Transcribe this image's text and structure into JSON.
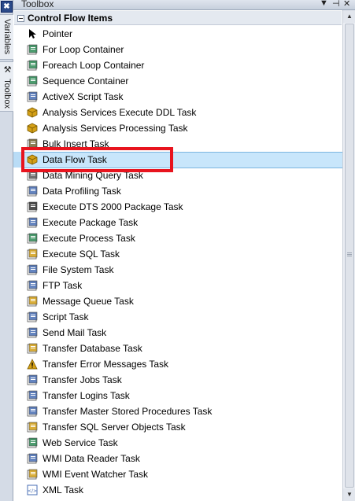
{
  "window": {
    "title": "Toolbox",
    "dropdown_glyph": "▼",
    "pin_glyph": "📌",
    "close_glyph": "✕"
  },
  "side_tabs": {
    "top_icon": "✖",
    "variables": "Variables",
    "toolbox": "Toolbox"
  },
  "group": {
    "label": "Control Flow Items"
  },
  "items": [
    {
      "label": "Pointer",
      "icon": "pointer-icon",
      "color": "#000000"
    },
    {
      "label": "For Loop Container",
      "icon": "for-loop-icon",
      "color": "#2e8b57"
    },
    {
      "label": "Foreach Loop Container",
      "icon": "foreach-loop-icon",
      "color": "#2e8b57"
    },
    {
      "label": "Sequence Container",
      "icon": "sequence-icon",
      "color": "#2e8b57"
    },
    {
      "label": "ActiveX Script Task",
      "icon": "activex-icon",
      "color": "#4a6fb5"
    },
    {
      "label": "Analysis Services Execute DDL Task",
      "icon": "cube-icon",
      "color": "#d4a017"
    },
    {
      "label": "Analysis Services Processing Task",
      "icon": "cube-icon",
      "color": "#d4a017"
    },
    {
      "label": "Bulk Insert Task",
      "icon": "bulk-insert-icon",
      "color": "#7a6a3a"
    },
    {
      "label": "Data Flow Task",
      "icon": "data-flow-icon",
      "color": "#d4a017"
    },
    {
      "label": "Data Mining Query Task",
      "icon": "mining-icon",
      "color": "#5a5a5a"
    },
    {
      "label": "Data Profiling Task",
      "icon": "profiling-icon",
      "color": "#4a6fb5"
    },
    {
      "label": "Execute DTS 2000 Package Task",
      "icon": "dts-icon",
      "color": "#333333"
    },
    {
      "label": "Execute Package Task",
      "icon": "package-icon",
      "color": "#4a6fb5"
    },
    {
      "label": "Execute Process Task",
      "icon": "process-icon",
      "color": "#2e8b57"
    },
    {
      "label": "Execute SQL Task",
      "icon": "sql-icon",
      "color": "#d4a017"
    },
    {
      "label": "File System Task",
      "icon": "file-system-icon",
      "color": "#4a6fb5"
    },
    {
      "label": "FTP Task",
      "icon": "ftp-icon",
      "color": "#4a6fb5"
    },
    {
      "label": "Message Queue Task",
      "icon": "message-queue-icon",
      "color": "#d4a017"
    },
    {
      "label": "Script Task",
      "icon": "script-icon",
      "color": "#4a6fb5"
    },
    {
      "label": "Send Mail Task",
      "icon": "mail-icon",
      "color": "#4a6fb5"
    },
    {
      "label": "Transfer Database Task",
      "icon": "transfer-db-icon",
      "color": "#d4a017"
    },
    {
      "label": "Transfer Error Messages Task",
      "icon": "warning-icon",
      "color": "#d4a017"
    },
    {
      "label": "Transfer Jobs Task",
      "icon": "jobs-icon",
      "color": "#4a6fb5"
    },
    {
      "label": "Transfer Logins Task",
      "icon": "logins-icon",
      "color": "#4a6fb5"
    },
    {
      "label": "Transfer Master Stored Procedures Task",
      "icon": "stored-proc-icon",
      "color": "#4a6fb5"
    },
    {
      "label": "Transfer SQL Server Objects Task",
      "icon": "sql-objects-icon",
      "color": "#d4a017"
    },
    {
      "label": "Web Service Task",
      "icon": "web-service-icon",
      "color": "#2e8b57"
    },
    {
      "label": "WMI Data Reader Task",
      "icon": "wmi-reader-icon",
      "color": "#4a6fb5"
    },
    {
      "label": "WMI Event Watcher Task",
      "icon": "wmi-watcher-icon",
      "color": "#d4a017"
    },
    {
      "label": "XML Task",
      "icon": "xml-icon",
      "color": "#4a6fb5"
    }
  ],
  "selected_index": 8,
  "colors": {
    "selection": "#c8e6fb",
    "highlight_box": "#e8141e",
    "header": "#e4e9f0"
  }
}
